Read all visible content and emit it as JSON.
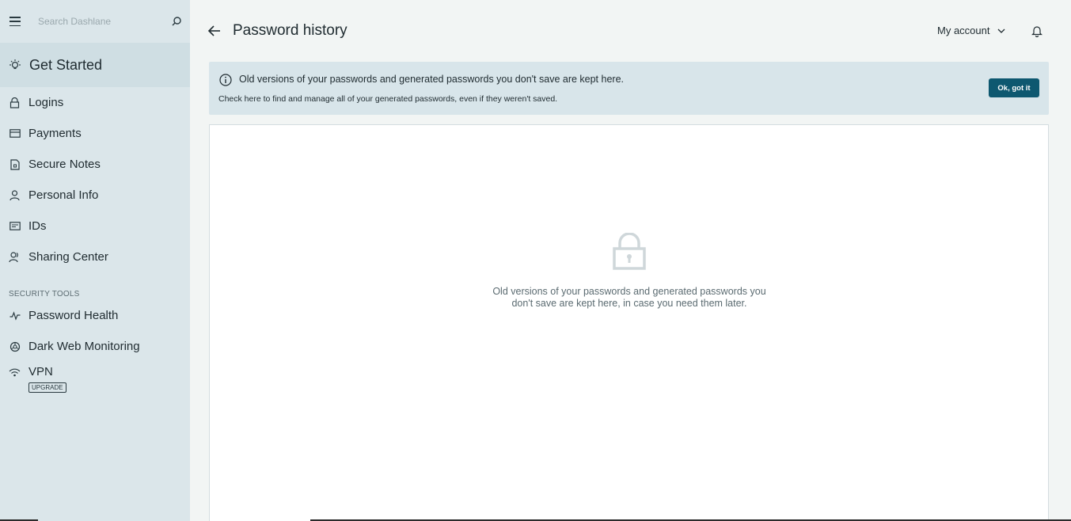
{
  "sidebar": {
    "search_placeholder": "Search Dashlane",
    "get_started": "Get Started",
    "items": [
      {
        "label": "Logins"
      },
      {
        "label": "Payments"
      },
      {
        "label": "Secure Notes"
      },
      {
        "label": "Personal Info"
      },
      {
        "label": "IDs"
      },
      {
        "label": "Sharing Center"
      }
    ],
    "security_section": "SECURITY TOOLS",
    "security_items": [
      {
        "label": "Password Health"
      },
      {
        "label": "Dark Web Monitoring"
      }
    ],
    "vpn": {
      "label": "VPN",
      "badge": "UPGRADE"
    }
  },
  "header": {
    "title": "Password history",
    "account_label": "My account"
  },
  "banner": {
    "message": "Old versions of your passwords and generated passwords you don't save are kept here.",
    "detail": "Check here to find and manage all of your generated passwords, even if they weren't saved.",
    "button": "Ok, got it"
  },
  "empty_state": {
    "line1": "Old versions of your passwords and generated passwords you",
    "line2": "don't save are kept here, in case you need them later."
  },
  "colors": {
    "sidebar_bg": "#dbe6ea",
    "active_bg": "#cfdee3",
    "banner_bg": "#d8e5ea",
    "accent": "#0e5870"
  }
}
